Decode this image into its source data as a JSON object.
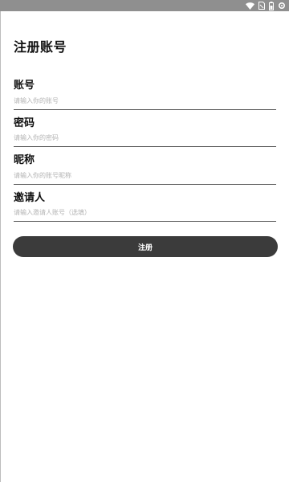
{
  "statusbar": {
    "icons": [
      "wifi-icon",
      "sim-icon",
      "battery-icon",
      "settings-icon"
    ],
    "background": "#8f8f8f"
  },
  "page": {
    "title": "注册账号"
  },
  "form": {
    "account": {
      "label": "账号",
      "placeholder": "请输入你的账号",
      "value": ""
    },
    "password": {
      "label": "密码",
      "placeholder": "请输入你的密码",
      "value": ""
    },
    "nickname": {
      "label": "昵称",
      "placeholder": "请输入你的账号昵称",
      "value": ""
    },
    "inviter": {
      "label": "邀请人",
      "placeholder": "请输入邀请人账号（选填）",
      "value": ""
    },
    "submit_label": "注册"
  },
  "colors": {
    "button": "#3b3b3b",
    "button_text": "#ffffff",
    "placeholder": "#b3b3b3",
    "underline": "#555555"
  }
}
